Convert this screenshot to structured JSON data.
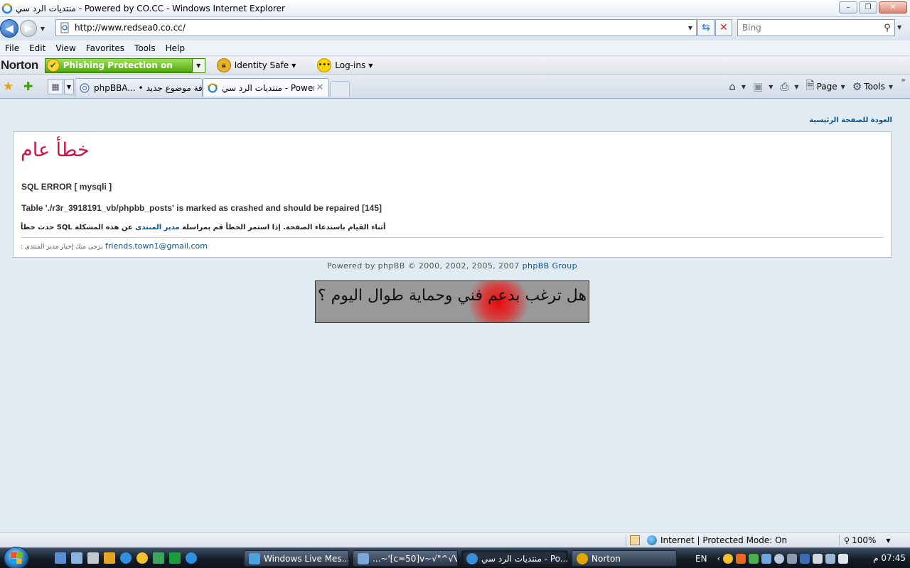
{
  "window": {
    "title": "منتديات الرد سي - Powered by CO.CC - Windows Internet Explorer",
    "controls": {
      "minimize": "–",
      "maximize": "❐",
      "close": "✕"
    }
  },
  "address_bar": {
    "url": "http://www.redsea0.co.cc/",
    "search_placeholder": "Bing"
  },
  "menu": [
    "File",
    "Edit",
    "View",
    "Favorites",
    "Tools",
    "Help"
  ],
  "norton_toolbar": {
    "logo": "Norton",
    "phishing_label": "Phishing Protection on",
    "identity_safe": "Identity Safe",
    "logins": "Log-ins"
  },
  "tabs": [
    {
      "label": "phpBBA... • إضافة موضوع جديد",
      "active": false
    },
    {
      "label": "منتديات الرد سي - Power...",
      "active": true
    }
  ],
  "command_bar": {
    "page": "Page",
    "tools": "Tools"
  },
  "page": {
    "back_link": "العودة للصفحة الرئيسية",
    "error_title": "خطأ عام",
    "sql_error": "SQL ERROR [ mysqli ]",
    "sql_detail": "Table './r3r_3918191_vb/phpbb_posts' is marked as crashed and should be repaired [145]",
    "msg_part1": "أثناء القيام باستدعاء الصفحة. إذا استمر الخطأ قم بمراسلة",
    "msg_link": "مدير المنتدى",
    "msg_part2": "عن هذه المشكلة SQL حدث خطأ",
    "contact_note": "يرجى منك إخبار مدير المنتدى :",
    "contact_email": "friends.town1@gmail.com",
    "powered_text": "Powered by phpBB © 2000, 2002, 2005, 2007",
    "powered_link": "phpBB Group",
    "banner_text": "هل ترغب بدعم فني وحماية طوال اليوم ؟"
  },
  "status_bar": {
    "zone": "Internet | Protected Mode: On",
    "zoom": "100%"
  },
  "taskbar": {
    "buttons": [
      {
        "label": "Windows Live Mes...",
        "color": "#4aa3df"
      },
      {
        "label": "...~'[c=50]v~√\"^√V",
        "color": "#7aa7d8"
      },
      {
        "label": "منتديات الرد سي - Po...",
        "color": "#3b8ed8"
      },
      {
        "label": "Norton",
        "color": "#e0a800"
      }
    ],
    "lang": "EN",
    "clock": "07:45 م"
  }
}
